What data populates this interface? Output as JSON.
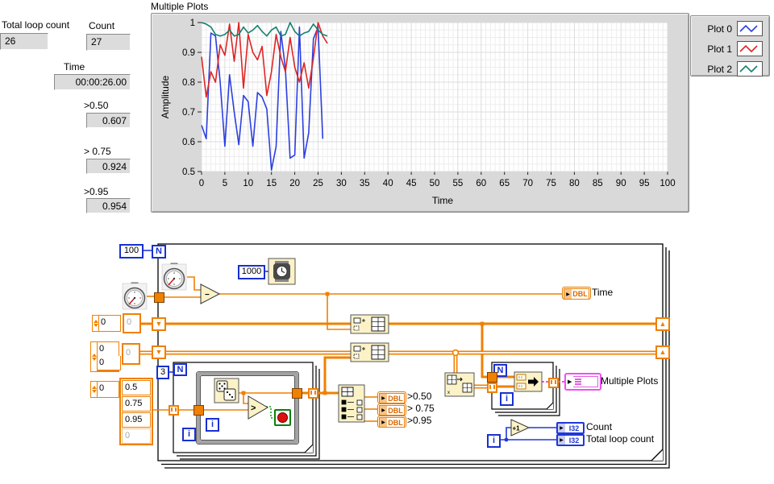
{
  "front_panel": {
    "indicators": [
      {
        "id": "total_loop_count",
        "label": "Total loop count",
        "value": "26"
      },
      {
        "id": "count",
        "label": "Count",
        "value": "27"
      },
      {
        "id": "time",
        "label": "Time",
        "value": "00:00:26.00"
      },
      {
        "id": "gt_050",
        "label": ">0.50",
        "value": "0.607"
      },
      {
        "id": "gt_075",
        "label": "> 0.75",
        "value": "0.924"
      },
      {
        "id": "gt_095",
        "label": ">0.95",
        "value": "0.954"
      }
    ]
  },
  "chart_data": {
    "type": "line",
    "title": "Multiple Plots",
    "xlabel": "Time",
    "ylabel": "Amplitude",
    "xlim": [
      0,
      100
    ],
    "ylim": [
      0.5,
      1
    ],
    "x_tick_step": 5,
    "y_tick_step": 0.1,
    "grid": true,
    "legend_position": "top-right",
    "x_start": 0,
    "series": [
      {
        "name": "Plot 0",
        "color": "#2b3fe0",
        "values": [
          0.655,
          0.61,
          0.965,
          0.955,
          0.8,
          0.585,
          0.825,
          0.7,
          0.59,
          0.755,
          0.735,
          0.585,
          0.765,
          0.75,
          0.71,
          0.505,
          0.585,
          0.97,
          0.845,
          0.545,
          0.555,
          0.985,
          0.545,
          0.63,
          0.945,
          0.985,
          0.61,
          null
        ]
      },
      {
        "name": "Plot 1",
        "color": "#e02424",
        "values": [
          0.885,
          0.75,
          0.835,
          0.8,
          0.925,
          0.89,
          0.995,
          0.87,
          1.0,
          0.78,
          0.96,
          0.9,
          0.875,
          0.92,
          0.755,
          0.835,
          0.96,
          0.885,
          0.835,
          0.95,
          0.85,
          0.8,
          0.865,
          0.78,
          0.88,
          1.0,
          0.955,
          0.93
        ]
      },
      {
        "name": "Plot 2",
        "color": "#12806e",
        "values": [
          1.0,
          0.995,
          0.985,
          0.96,
          0.955,
          0.96,
          0.975,
          0.955,
          0.96,
          0.985,
          0.965,
          0.975,
          0.99,
          0.97,
          0.955,
          0.975,
          0.985,
          0.955,
          0.96,
          1.0,
          0.97,
          0.955,
          0.965,
          0.97,
          0.995,
          0.975,
          0.96,
          0.955
        ]
      }
    ]
  },
  "block_diagram": {
    "constants": {
      "outer_n": "100",
      "wait_ms": "1000",
      "inner_n": "3",
      "index_zero": "0",
      "sr1_elem": "0",
      "sr2_index_a": "0",
      "sr2_index_b": "0",
      "sr2_elem": "0",
      "thresholds": [
        "0.5",
        "0.75",
        "0.95"
      ],
      "threshold_next": "0"
    },
    "terminals": {
      "n": "N",
      "i": "i",
      "dbl": "DBL",
      "i32": "I32",
      "plus_one": "+1",
      "greater": ">",
      "subtract": "−"
    },
    "glyphs": {
      "output_arrow": "▶"
    },
    "labels": {
      "time": "Time",
      "multiple_plots": "Multiple Plots",
      "count": "Count",
      "total_loop_count": "Total loop count",
      "gt_050": ">0.50",
      "gt_075": "> 0.75",
      "gt_095": ">0.95"
    },
    "colors": {
      "wire_orange": "#f08000",
      "wire_blue": "#2038d8",
      "wire_green": "#0aa00a",
      "wire_pink": "#f050f0",
      "node_yellow": "#fbf2c8"
    }
  }
}
